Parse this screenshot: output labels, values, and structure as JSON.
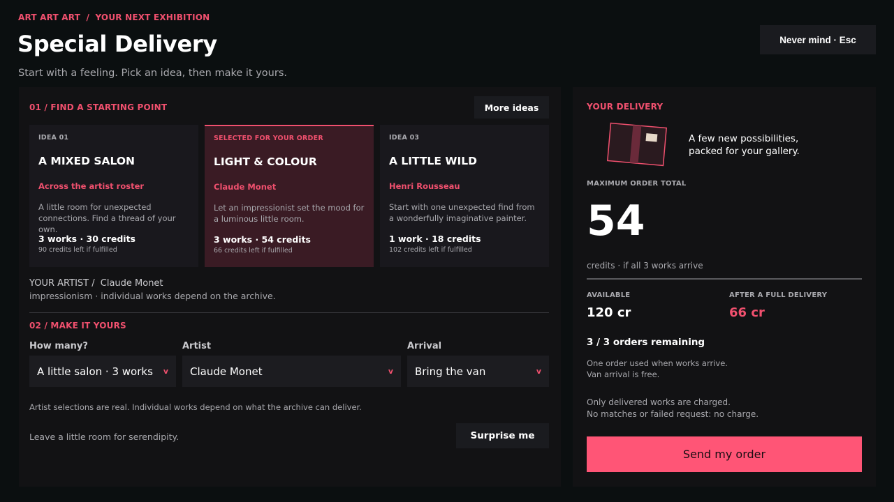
{
  "header": {
    "breadcrumb_root": "ART ART ART",
    "breadcrumb_sep": "/",
    "breadcrumb_current": "YOUR NEXT EXHIBITION",
    "title": "Special Delivery",
    "subtitle": "Start with a feeling. Pick an idea, then make it yours.",
    "escape_button": "Never mind · Esc"
  },
  "ideas_section": {
    "label": "01 / FIND A STARTING POINT",
    "more_ideas_button": "More ideas",
    "cards": [
      {
        "kicker": "IDEA 01",
        "title": "A MIXED SALON",
        "artist": "Across the artist roster",
        "description": "A little room for unexpected connections. Find a thread of your own.",
        "stats": "3 works · 30 credits",
        "remaining": "90 credits left if fulfilled",
        "selected": false
      },
      {
        "kicker": "SELECTED FOR YOUR ORDER",
        "title": "LIGHT & COLOUR",
        "artist": "Claude Monet",
        "description": "Let an impressionist set the mood for a luminous little room.",
        "stats": "3 works · 54 credits",
        "remaining": "66 credits left if fulfilled",
        "selected": true
      },
      {
        "kicker": "IDEA 03",
        "title": "A LITTLE WILD",
        "artist": "Henri Rousseau",
        "description": "Start with one unexpected find from a wonderfully imaginative painter.",
        "stats": "1 work · 18 credits",
        "remaining": "102 credits left if fulfilled",
        "selected": false
      }
    ],
    "your_artist_label": "YOUR ARTIST /",
    "your_artist_value": "Claude Monet",
    "your_artist_note": "impressionism · individual works depend on the archive."
  },
  "make_section": {
    "label": "02 / MAKE IT YOURS",
    "fields": [
      {
        "label": "How many?",
        "value": "A little salon · 3 works"
      },
      {
        "label": "Artist",
        "value": "Claude Monet"
      },
      {
        "label": "Arrival",
        "value": "Bring the van"
      }
    ],
    "chevron": "v",
    "note": "Artist selections are real. Individual works depend on what the archive can deliver.",
    "serendipity_note": "Leave a little room for serendipity.",
    "surprise_button": "Surprise me"
  },
  "delivery": {
    "label": "YOUR DELIVERY",
    "tagline_line1": "A few new possibilities,",
    "tagline_line2": "packed for your gallery.",
    "max_total_label": "MAXIMUM ORDER TOTAL",
    "max_total_value": "54",
    "max_total_note": "credits · if all 3 works arrive",
    "available_label": "AVAILABLE",
    "available_value": "120 cr",
    "after_label": "AFTER A FULL DELIVERY",
    "after_value": "66 cr",
    "orders_remaining": "3 / 3 orders remaining",
    "order_note1": "One order used when works arrive.",
    "order_note2": "Van arrival is free.",
    "charge_note1": "Only delivered works are charged.",
    "charge_note2": "No matches or failed request: no charge.",
    "send_button": "Send my order"
  },
  "colors": {
    "accent": "#f0506e",
    "send_button": "#ff5576",
    "background": "#0b0f10",
    "panel": "#121214",
    "selected_card": "#3a1b24"
  }
}
